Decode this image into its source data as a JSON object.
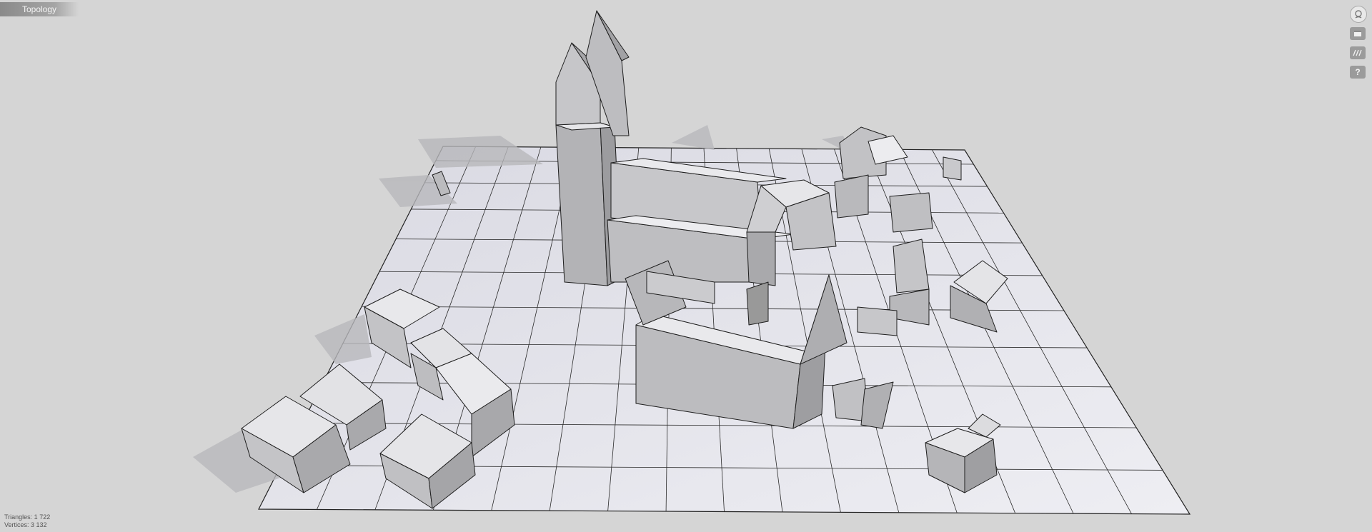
{
  "app": {
    "tab_label": "Topology"
  },
  "toolbar": {
    "buttons": [
      {
        "name": "view-cube",
        "icon": "cube-head-icon"
      },
      {
        "name": "display-mode",
        "icon": "window-icon"
      },
      {
        "name": "texture-mode",
        "icon": "stripes-icon"
      },
      {
        "name": "help",
        "icon": "question-icon",
        "label": "?"
      }
    ]
  },
  "stats": {
    "triangles": "Triangles: 1 722",
    "vertices": "Vertices: 3 132"
  },
  "colors": {
    "background": "#d5d5d5",
    "ground": "#ededf2",
    "grid": "#2a2a2a",
    "building_face": "#c9c9cc",
    "building_top": "#ececef"
  }
}
